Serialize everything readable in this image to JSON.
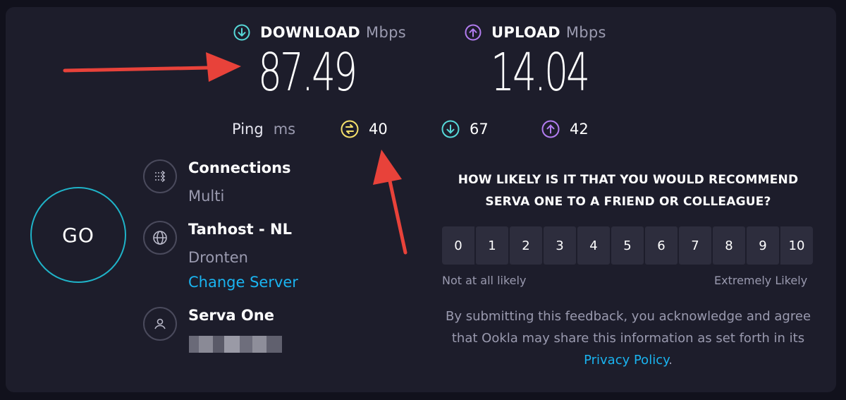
{
  "download": {
    "label": "DOWNLOAD",
    "unit": "Mbps",
    "value": "87.49",
    "icon": "download-icon",
    "color": "#56d8d8"
  },
  "upload": {
    "label": "UPLOAD",
    "unit": "Mbps",
    "value": "14.04",
    "icon": "upload-icon",
    "color": "#b27cf0"
  },
  "ping": {
    "label": "Ping",
    "unit": "ms",
    "idle": "40",
    "download": "67",
    "upload": "42",
    "idle_color": "#f5e06b"
  },
  "connections": {
    "title": "Connections",
    "value": "Multi",
    "icon": "connections-icon"
  },
  "server": {
    "title": "Tanhost - NL",
    "location": "Dronten",
    "change_label": "Change Server",
    "icon": "globe-icon"
  },
  "provider": {
    "title": "Serva One",
    "value_redacted": true,
    "icon": "user-icon"
  },
  "go_button": {
    "label": "GO",
    "color": "#1fb3c8"
  },
  "survey": {
    "question": "HOW LIKELY IS IT THAT YOU WOULD RECOMMEND SERVA ONE TO A FRIEND OR COLLEAGUE?",
    "scale": [
      "0",
      "1",
      "2",
      "3",
      "4",
      "5",
      "6",
      "7",
      "8",
      "9",
      "10"
    ],
    "low_label": "Not at all likely",
    "high_label": "Extremely Likely",
    "disclaimer_prefix": "By submitting this feedback, you acknowledge and agree that Ookla may share this information as set forth in its ",
    "privacy_link": "Privacy Policy",
    "disclaimer_suffix": "."
  },
  "annotations": {
    "arrow_color": "#e8423a"
  }
}
